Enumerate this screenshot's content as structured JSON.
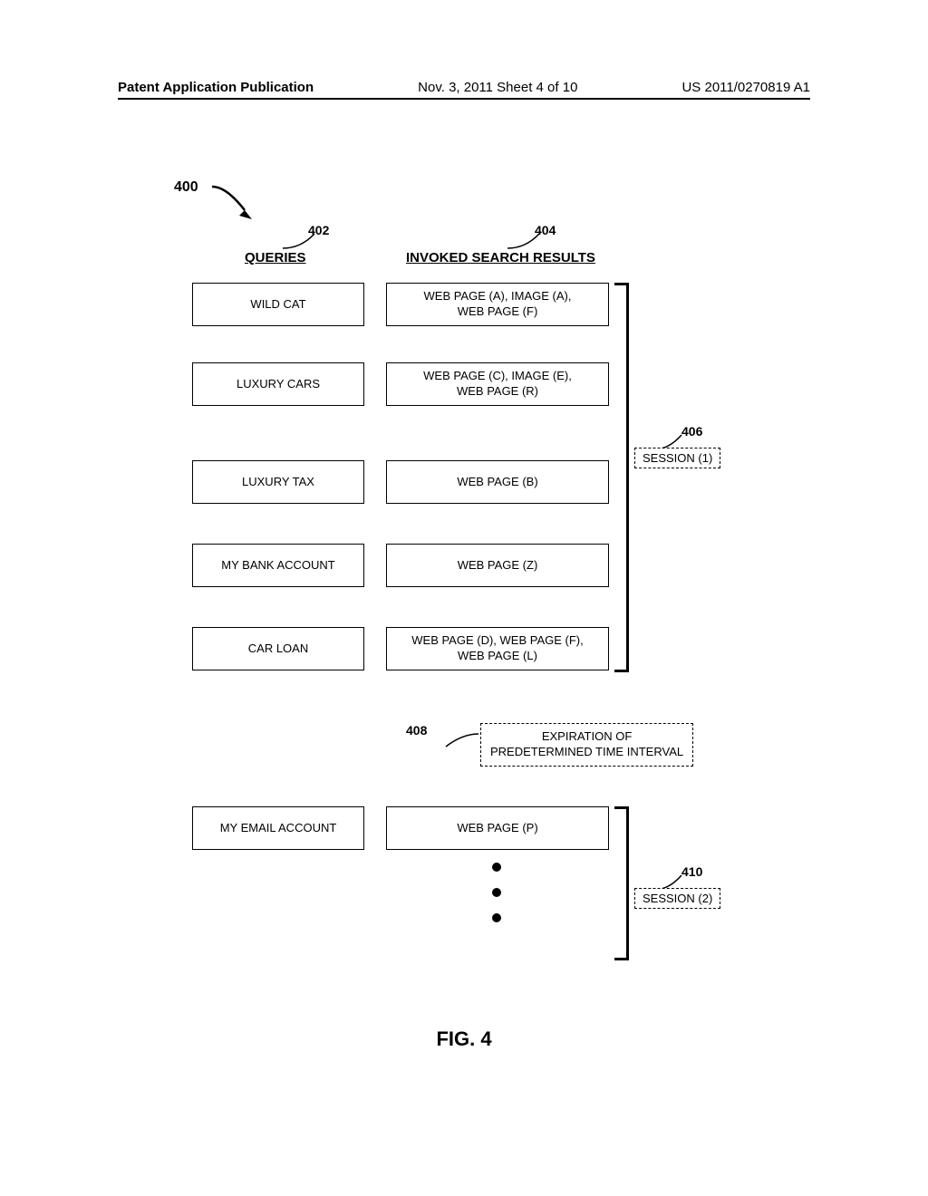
{
  "header": {
    "left": "Patent Application Publication",
    "center": "Nov. 3, 2011   Sheet 4 of 10",
    "right": "US 2011/0270819 A1"
  },
  "refs": {
    "r400": "400",
    "r402": "402",
    "r404": "404",
    "r406": "406",
    "r408": "408",
    "r410": "410"
  },
  "columns": {
    "queries": "QUERIES",
    "results": "INVOKED SEARCH RESULTS"
  },
  "rows": [
    {
      "query": "WILD CAT",
      "result": "WEB PAGE (A), IMAGE (A),\nWEB PAGE (F)"
    },
    {
      "query": "LUXURY CARS",
      "result": "WEB PAGE (C), IMAGE (E),\nWEB PAGE (R)"
    },
    {
      "query": "LUXURY TAX",
      "result": "WEB PAGE (B)"
    },
    {
      "query": "MY BANK ACCOUNT",
      "result": "WEB PAGE (Z)"
    },
    {
      "query": "CAR LOAN",
      "result": "WEB PAGE (D), WEB PAGE (F),\nWEB PAGE (L)"
    },
    {
      "query": "MY EMAIL ACCOUNT",
      "result": "WEB PAGE (P)"
    }
  ],
  "session1": "SESSION (1)",
  "session2": "SESSION (2)",
  "expiration": "EXPIRATION OF\nPREDETERMINED TIME INTERVAL",
  "figure_caption": "FIG. 4",
  "chart_data": {
    "type": "table",
    "title": "FIG. 4 — Queries and invoked search results grouped into sessions",
    "columns": [
      "QUERIES",
      "INVOKED SEARCH RESULTS",
      "SESSION"
    ],
    "rows": [
      [
        "WILD CAT",
        "WEB PAGE (A), IMAGE (A), WEB PAGE (F)",
        "SESSION (1)"
      ],
      [
        "LUXURY CARS",
        "WEB PAGE (C), IMAGE (E), WEB PAGE (R)",
        "SESSION (1)"
      ],
      [
        "LUXURY TAX",
        "WEB PAGE (B)",
        "SESSION (1)"
      ],
      [
        "MY BANK ACCOUNT",
        "WEB PAGE (Z)",
        "SESSION (1)"
      ],
      [
        "CAR LOAN",
        "WEB PAGE (D), WEB PAGE (F), WEB PAGE (L)",
        "SESSION (1)"
      ],
      [
        "MY EMAIL ACCOUNT",
        "WEB PAGE (P)",
        "SESSION (2)"
      ]
    ],
    "annotations": {
      "400": "overall diagram reference",
      "402": "QUERIES column header",
      "404": "INVOKED SEARCH RESULTS column header",
      "406": "SESSION (1) bracket",
      "408": "EXPIRATION OF PREDETERMINED TIME INTERVAL (session boundary)",
      "410": "SESSION (2) bracket"
    }
  }
}
